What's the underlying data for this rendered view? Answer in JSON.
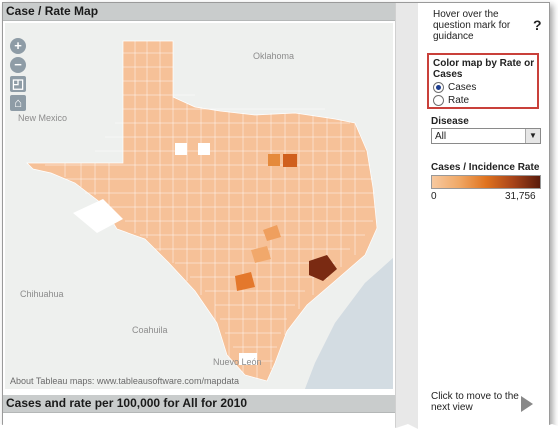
{
  "map_panel": {
    "title": "Case / Rate Map",
    "labels": {
      "oklahoma": "Oklahoma",
      "new_mexico": "New Mexico",
      "chihuahua": "Chihuahua",
      "coahuila": "Coahuila",
      "nuevo_leon": "Nuevo León"
    },
    "attribution": "About Tableau maps: www.tableausoftware.com/mapdata",
    "zoom_in": "+",
    "zoom_out": "−"
  },
  "bottom_panel": {
    "title": "Cases and rate per 100,000 for All for 2010"
  },
  "sidebar": {
    "guidance_text": "Hover over the question mark for guidance",
    "question_mark": "?",
    "color_by": {
      "title": "Color map by Rate or Cases",
      "options": [
        "Cases",
        "Rate"
      ],
      "selected": "Cases"
    },
    "disease": {
      "label": "Disease",
      "value": "All"
    },
    "legend": {
      "title": "Cases / Incidence Rate",
      "min": "0",
      "max": "31,756"
    },
    "next_view": "Click to move to the next view"
  }
}
